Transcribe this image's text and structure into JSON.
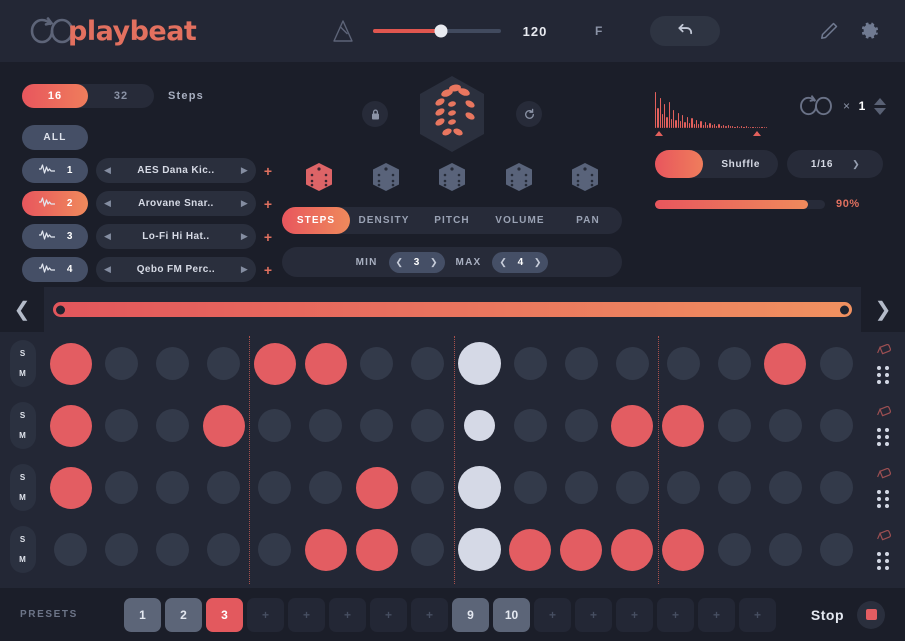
{
  "app": {
    "brand": "playbeat",
    "logo_icon": "loop-infinity-icon"
  },
  "toolbar": {
    "metronome_icon": "metronome-icon",
    "tempo": "120",
    "tempo_percent": 53,
    "key": "F",
    "undo_icon": "undo-arrow-icon",
    "edit_icon": "pencil-icon",
    "settings_icon": "gear-icon"
  },
  "steps_section": {
    "options": [
      "16",
      "32"
    ],
    "selected": "16",
    "label": "Steps",
    "all_label": "ALL"
  },
  "tracks": [
    {
      "num": "1",
      "name": "AES Dana Kic..",
      "selected": false
    },
    {
      "num": "2",
      "name": "Arovane Snar..",
      "selected": true
    },
    {
      "num": "3",
      "name": "Lo-Fi Hi Hat..",
      "selected": false
    },
    {
      "num": "4",
      "name": "Qebo FM Perc..",
      "selected": false
    }
  ],
  "dice": {
    "lock_icon": "lock-icon",
    "reset_icon": "reset-circular-arrow-icon",
    "big_dice_icon": "big-dice-icon",
    "small_dice": [
      {
        "icon": "dice-1-icon",
        "active": true
      },
      {
        "icon": "dice-2-icon",
        "active": false
      },
      {
        "icon": "dice-3-icon",
        "active": false
      },
      {
        "icon": "dice-4-icon",
        "active": false
      },
      {
        "icon": "dice-5-icon",
        "active": false
      }
    ]
  },
  "tabs": {
    "items": [
      "STEPS",
      "DENSITY",
      "PITCH",
      "VOLUME",
      "PAN"
    ],
    "selected": "STEPS"
  },
  "minmax": {
    "min_label": "MIN",
    "min_value": "3",
    "max_label": "MAX",
    "max_value": "4",
    "prev_icon": "chevron-left-icon",
    "next_icon": "chevron-right-icon"
  },
  "right_panel": {
    "waveform_icon": "waveform-decay-icon",
    "loop_icon": "loop-infinity-icon",
    "multiply_sign": "×",
    "loop_count": "1",
    "spin_up_icon": "triangle-up-icon",
    "spin_down_icon": "triangle-down-icon",
    "shuffle_label": "Shuffle",
    "shuffle_on": true,
    "quantize_value": "1/16",
    "quantize_chevron": "chevron-down-icon",
    "amount_percent": 90,
    "amount_label": "90%"
  },
  "range_strip": {
    "prev_icon": "chevron-left-icon",
    "next_icon": "chevron-right-icon",
    "start_percent": 0,
    "end_percent": 100
  },
  "sequencer": {
    "solo_label": "S",
    "mute_label": "M",
    "step_count": 16,
    "playhead_step": 9,
    "eraser_icon": "eraser-icon",
    "drag_icon": "drag-dots-icon",
    "rows": [
      {
        "track": "1",
        "steps": [
          1,
          0,
          0,
          0,
          1,
          1,
          0,
          0,
          0,
          0,
          0,
          0,
          0,
          0,
          1,
          0
        ]
      },
      {
        "track": "2",
        "steps": [
          1,
          0,
          0,
          1,
          0,
          0,
          0,
          0,
          0,
          0,
          0,
          1,
          1,
          0,
          0,
          0
        ]
      },
      {
        "track": "3",
        "steps": [
          1,
          0,
          0,
          0,
          0,
          0,
          1,
          0,
          0,
          0,
          0,
          0,
          0,
          0,
          0,
          0
        ]
      },
      {
        "track": "4",
        "steps": [
          0,
          0,
          0,
          0,
          0,
          1,
          1,
          0,
          0,
          1,
          1,
          1,
          1,
          0,
          0,
          0
        ]
      }
    ]
  },
  "presets": {
    "label": "PRESETS",
    "empty_glyph": "+",
    "slots": [
      {
        "label": "1",
        "state": "used"
      },
      {
        "label": "2",
        "state": "used"
      },
      {
        "label": "3",
        "state": "on"
      },
      {
        "label": "+",
        "state": "empty"
      },
      {
        "label": "+",
        "state": "empty"
      },
      {
        "label": "+",
        "state": "empty"
      },
      {
        "label": "+",
        "state": "empty"
      },
      {
        "label": "+",
        "state": "empty"
      },
      {
        "label": "9",
        "state": "used"
      },
      {
        "label": "10",
        "state": "used"
      },
      {
        "label": "+",
        "state": "empty"
      },
      {
        "label": "+",
        "state": "empty"
      },
      {
        "label": "+",
        "state": "empty"
      },
      {
        "label": "+",
        "state": "empty"
      },
      {
        "label": "+",
        "state": "empty"
      },
      {
        "label": "+",
        "state": "empty"
      }
    ],
    "stop_label": "Stop",
    "stop_icon": "stop-square-icon"
  },
  "colors": {
    "accent_red": "#e35d62",
    "accent_orange": "#ef8a5c",
    "bg": "#1b1e29",
    "panel": "#232735"
  }
}
